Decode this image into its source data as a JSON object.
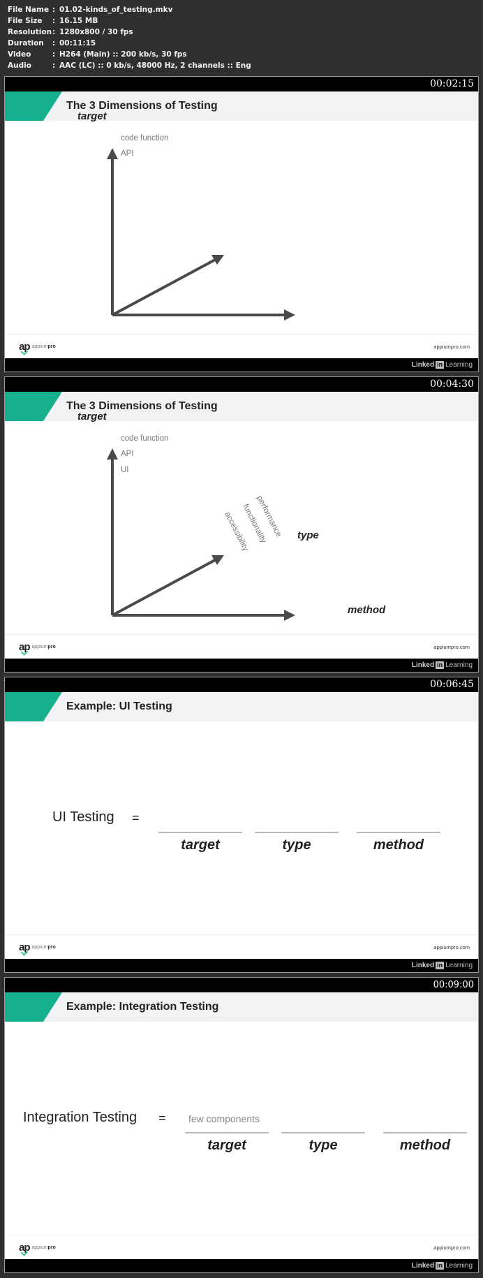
{
  "file_info": [
    {
      "key": "File Name",
      "value": "01.02-kinds_of_testing.mkv"
    },
    {
      "key": "File Size",
      "value": "16.15 MB"
    },
    {
      "key": "Resolution",
      "value": "1280x800 / 30 fps"
    },
    {
      "key": "Duration",
      "value": "00:11:15"
    },
    {
      "key": "Video",
      "value": "H264 (Main) :: 200 kb/s, 30 fps"
    },
    {
      "key": "Audio",
      "value": "AAC (LC) :: 0 kb/s, 48000 Hz, 2 channels :: Eng"
    }
  ],
  "colors": {
    "accent": "#16b08e",
    "title_band": "#f1f2f4",
    "bar": "#000000",
    "background": "#2f2f2f"
  },
  "common": {
    "logo_mark": "ap",
    "logo_text_light": "appium",
    "logo_text_bold": "pro",
    "site": "appiumpro.com",
    "brand_left": "Linked",
    "brand_in": "in",
    "brand_right": "Learning",
    "separator": ":"
  },
  "frames": [
    {
      "timestamp": "00:02:15",
      "title": "The 3 Dimensions of Testing",
      "axes": {
        "y_label": "target",
        "y_items": [
          "code function",
          "API"
        ]
      }
    },
    {
      "timestamp": "00:04:30",
      "title": "The 3 Dimensions of Testing",
      "axes": {
        "y_label": "target",
        "y_items": [
          "code function",
          "API",
          "UI"
        ],
        "diag_label": "type",
        "diag_items": [
          "accessibility",
          "functionality",
          "performance"
        ],
        "x_label": "method"
      }
    },
    {
      "timestamp": "00:06:45",
      "title": "Example: UI Testing",
      "equation": {
        "lhs": "UI Testing",
        "sign": "=",
        "blanks": [
          "target",
          "type",
          "method"
        ],
        "values": [
          "",
          "",
          ""
        ]
      }
    },
    {
      "timestamp": "00:09:00",
      "title": "Example: Integration Testing",
      "equation": {
        "lhs": "Integration Testing",
        "sign": "=",
        "blanks": [
          "target",
          "type",
          "method"
        ],
        "values": [
          "few components",
          "",
          ""
        ]
      }
    }
  ]
}
